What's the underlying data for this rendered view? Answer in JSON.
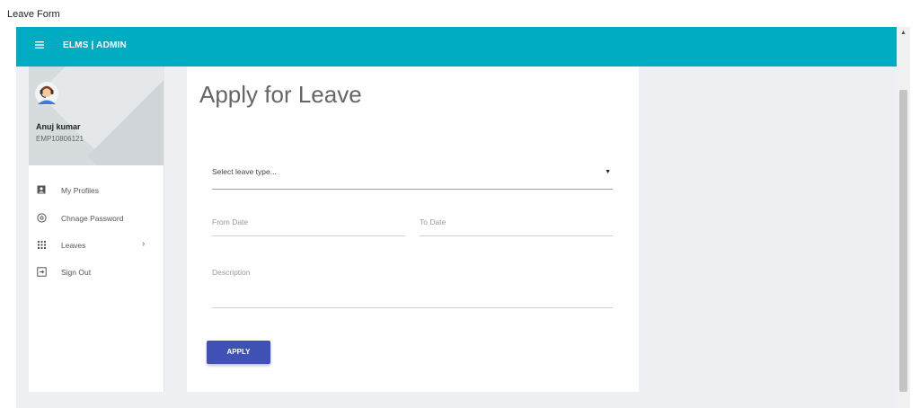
{
  "caption": "Leave Form",
  "header": {
    "brand": "ELMS | ADMIN",
    "menu_icon": "hamburger-icon",
    "color": "#00acc1"
  },
  "user": {
    "name": "Anuj kumar",
    "id": "EMP10806121",
    "avatar_icon": "support-agent-avatar"
  },
  "sidebar": {
    "items": [
      {
        "label": "My Profiles",
        "icon": "account-box-icon"
      },
      {
        "label": "Chnage Password",
        "icon": "settings-circle-icon"
      },
      {
        "label": "Leaves",
        "icon": "grid-dots-icon",
        "has_submenu": true
      },
      {
        "label": "Sign Out",
        "icon": "exit-icon"
      }
    ]
  },
  "form": {
    "title": "Apply for Leave",
    "leave_type_placeholder": "Select leave type...",
    "from_date_placeholder": "From Date",
    "to_date_placeholder": "To Date",
    "description_placeholder": "Description",
    "submit_label": "APPLY",
    "button_color": "#3f51b5"
  }
}
